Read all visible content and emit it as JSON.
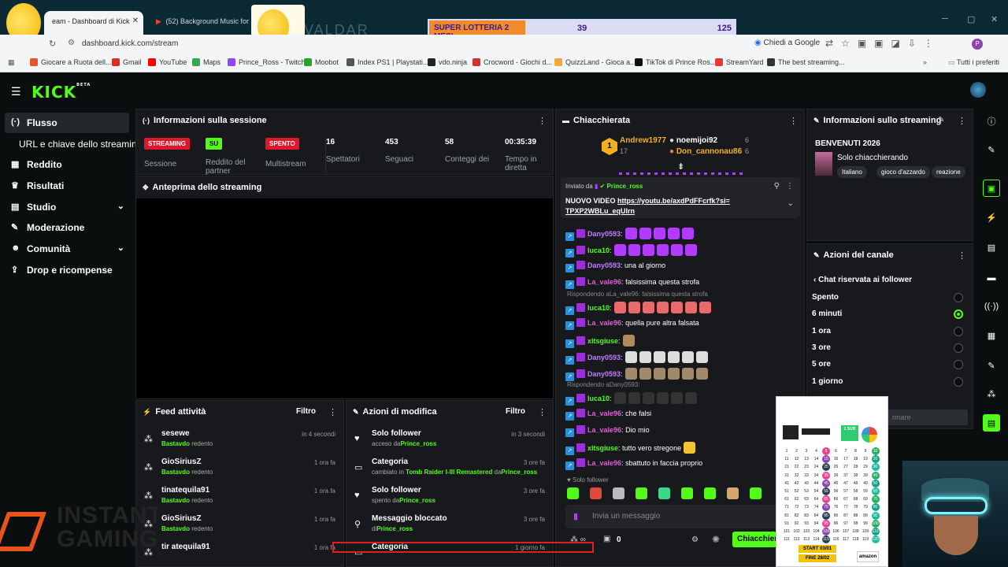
{
  "browser": {
    "tabs": [
      {
        "title": "eam - Dashboard di Kick",
        "active": true
      },
      {
        "title": "(52) Background Music for Gam",
        "active": false
      }
    ],
    "url": "dashboard.kick.com/stream",
    "chiedi": "Chiedi a Google",
    "overlay_text": "VALDAR",
    "bookmarks": [
      {
        "label": "Giocare a Ruota dell...",
        "color": "#e4572e"
      },
      {
        "label": "Gmail",
        "color": "#d93025"
      },
      {
        "label": "YouTube",
        "color": "#ff0000"
      },
      {
        "label": "Maps",
        "color": "#34a853"
      },
      {
        "label": "Prince_Ross - Twitch",
        "color": "#9146ff"
      },
      {
        "label": "Moobot",
        "color": "#2ca02c"
      },
      {
        "label": "Index PS1 | Playstati...",
        "color": "#555555"
      },
      {
        "label": "vdo.ninja",
        "color": "#222222"
      },
      {
        "label": "Crocword - Giochi d...",
        "color": "#cc3333"
      },
      {
        "label": "QuizzLand - Gioca a...",
        "color": "#f2a93b"
      },
      {
        "label": "TikTok di Prince Ros...",
        "color": "#111111"
      },
      {
        "label": "StreamYard",
        "color": "#e53935"
      },
      {
        "label": "The best streaming...",
        "color": "#333333"
      }
    ],
    "all_favorites": "Tutti i preferiti"
  },
  "lottery": {
    "label": "SUPER LOTTERIA 2 MESI",
    "current": "39",
    "total": "125"
  },
  "sidebar": {
    "items": [
      {
        "label": "Flusso",
        "icon": "stream-icon",
        "active": true
      },
      {
        "label": "URL e chiave dello streaming",
        "icon": "",
        "active": false
      },
      {
        "label": "Reddito",
        "icon": "revenue-icon",
        "active": false
      },
      {
        "label": "Risultati",
        "icon": "trophy-icon",
        "active": false
      },
      {
        "label": "Studio",
        "icon": "studio-icon",
        "active": false,
        "expand": true
      },
      {
        "label": "Moderazione",
        "icon": "wrench-icon",
        "active": false
      },
      {
        "label": "Comunità",
        "icon": "community-icon",
        "active": false,
        "expand": true
      },
      {
        "label": "Drop e ricompense",
        "icon": "drops-icon",
        "active": false
      }
    ]
  },
  "session": {
    "title": "Informazioni sulla sessione",
    "cols": [
      {
        "value": "STREAMING",
        "label": "Sessione",
        "badge": "#e0162b"
      },
      {
        "value": "SU",
        "label": "Reddito del partner",
        "badge": "#53fc18"
      },
      {
        "value": "SPENTO",
        "label": "Multistream",
        "badge": "#e0162b"
      },
      {
        "value": "16",
        "label": "Spettatori"
      },
      {
        "value": "453",
        "label": "Seguaci"
      },
      {
        "value": "58",
        "label": "Conteggi dei"
      },
      {
        "value": "00:35:39",
        "label": "Tempo in diretta"
      }
    ]
  },
  "preview": {
    "title": "Anteprima dello streaming"
  },
  "feed": {
    "title": "Feed attività",
    "filter": "Filtro",
    "items": [
      {
        "name": "sesewe",
        "who": "Bastavdo",
        "action": "redento",
        "time": "in 4 secondi"
      },
      {
        "name": "GioSiriusZ",
        "who": "Bastavdo",
        "action": "redento",
        "time": "1 ora fa"
      },
      {
        "name": "tinatequila91",
        "who": "Bastavdo",
        "action": "redento",
        "time": "1 ora fa"
      },
      {
        "name": "GioSiriusZ",
        "who": "Bastavdo",
        "action": "redento",
        "time": "1 ora fa"
      },
      {
        "name": "tir atequila91",
        "who": "",
        "action": "",
        "time": "1 ora fa"
      }
    ]
  },
  "mod": {
    "title": "Azioni di modifica",
    "filter": "Filtro",
    "items": [
      {
        "name": "Solo follower",
        "pre": "acceso da",
        "who": "Prince_ross",
        "time": "in 3 secondi",
        "icon": "heart-icon"
      },
      {
        "name": "Categoria",
        "pre": "cambiato in",
        "who": "Tomb Raider I-III Remastered",
        "mid": " da",
        "who2": "Prince_ross",
        "time": "3 ore fa",
        "icon": "category-icon"
      },
      {
        "name": "Solo follower",
        "pre": "spento da",
        "who": "Prince_ross",
        "time": "3 ore fa",
        "icon": "heart-icon"
      },
      {
        "name": "Messaggio bloccato",
        "pre": "di",
        "who": "Prince_ross",
        "time": "3 ore fa",
        "icon": "pin-icon"
      },
      {
        "name": "Categoria",
        "pre": "",
        "who": "",
        "time": "1 giorno fa",
        "icon": "category-icon"
      }
    ]
  },
  "chat": {
    "title": "Chiacchierata",
    "top": [
      {
        "name": "Andrew1977",
        "count": "17"
      },
      {
        "name": "noemijoi92",
        "count": "6"
      },
      {
        "name": "Don_cannonau86",
        "count": "6"
      }
    ],
    "pinned": {
      "sent_by": "Inviato da",
      "author": "Prince_ross",
      "text": "NUOVO VIDEO ",
      "link": "https://youtu.be/axdPdFFcrfk?si=TPXP2WBLu_eqUlrn"
    },
    "messages": [
      {
        "user": "Dany0593",
        "color": "#c07bff",
        "text": "",
        "emotes": 5,
        "emote_color": "#b13bff"
      },
      {
        "user": "luca10",
        "color": "#53fc18",
        "text": "",
        "emotes": 6,
        "emote_color": "#b13bff"
      },
      {
        "user": "Dany0593",
        "color": "#c07bff",
        "text": " una al giorno",
        "emotes": 0
      },
      {
        "user": "La_vale96",
        "color": "#e05cd6",
        "text": " falsissima questa strofa",
        "emotes": 0
      },
      {
        "reply": "Rispondendo aLa_vale96: falsissima questa strofa"
      },
      {
        "user": "luca10",
        "color": "#53fc18",
        "text": "",
        "emotes": 7,
        "emote_color": "#e86a6a"
      },
      {
        "user": "La_vale96",
        "color": "#e05cd6",
        "text": " quella pure altra falsata",
        "emotes": 0
      },
      {
        "user": "xitsgiuse",
        "color": "#53fc18",
        "text": "",
        "emotes": 1,
        "emote_color": "#b08a5a"
      },
      {
        "user": "Dany0593",
        "color": "#c07bff",
        "text": "",
        "emotes": 6,
        "emote_color": "#dddddd"
      },
      {
        "user": "Dany0593",
        "color": "#c07bff",
        "text": "",
        "emotes": 6,
        "emote_color": "#a08a6a"
      },
      {
        "reply": "Rispondendo aDany0593:"
      },
      {
        "user": "luca10",
        "color": "#53fc18",
        "text": "",
        "emotes": 6,
        "emote_color": "#333333"
      },
      {
        "user": "La_vale96",
        "color": "#e05cd6",
        "text": " che falsi",
        "emotes": 0
      },
      {
        "user": "La_vale96",
        "color": "#e05cd6",
        "text": " Dio mio",
        "emotes": 0
      },
      {
        "user": "xitsgiuse",
        "color": "#53fc18",
        "text": " tutto vero stregone",
        "emotes": 1,
        "emote_color": "#f4c430"
      },
      {
        "user": "La_vale96",
        "color": "#e05cd6",
        "text": " sbattuto in faccia proprio",
        "emotes": 0
      }
    ],
    "followers_only": "Solo follower",
    "input_placeholder": "Invia un messaggio",
    "bottom_count": "0",
    "send_label": "Chiacchiera"
  },
  "stream_info": {
    "title": "Informazioni sullo streaming",
    "stream_title": "BENVENUTI 2026",
    "category": "Solo chiacchierando",
    "tags": [
      "Italiano",
      "gioco d'azzardo",
      "reazione"
    ]
  },
  "channel_actions": {
    "title": "Azioni del canale",
    "sub_title": "Chat riservata ai follower",
    "options": [
      {
        "label": "Spento",
        "selected": false
      },
      {
        "label": "6 minuti",
        "selected": true
      },
      {
        "label": "1 ora",
        "selected": false
      },
      {
        "label": "3 ore",
        "selected": false
      },
      {
        "label": "5 ore",
        "selected": false
      },
      {
        "label": "1 giorno",
        "selected": false
      }
    ],
    "confirm": "rmare"
  },
  "overlay_card": {
    "sub_label": "1 SUB",
    "start": "START 03/01",
    "end": "FINE 28/02",
    "brand": "amazon"
  },
  "instant_gaming": "INSTANT GAMING"
}
